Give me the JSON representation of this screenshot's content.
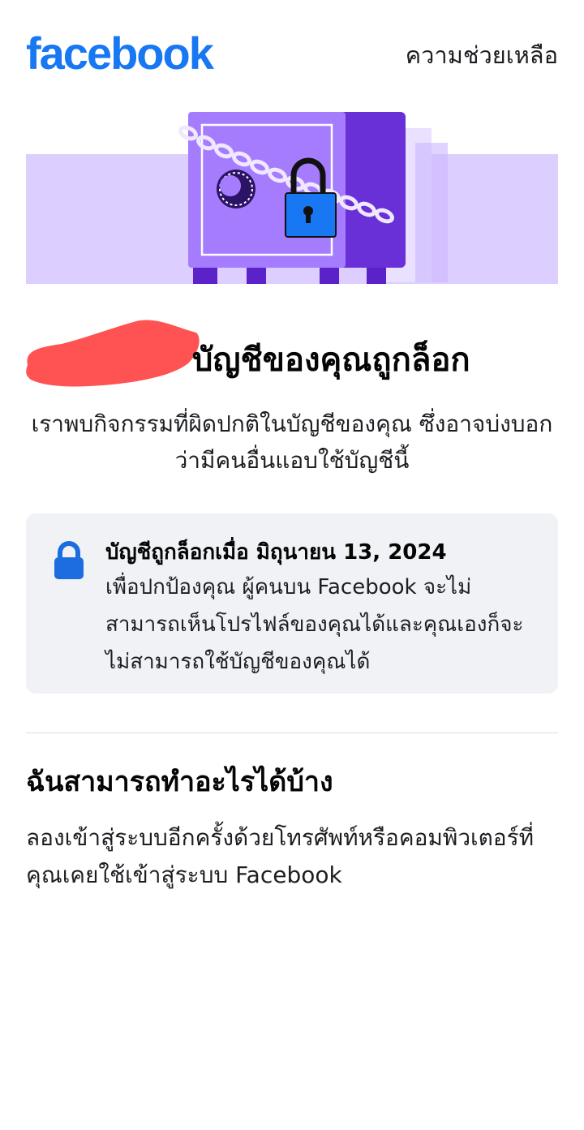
{
  "header": {
    "logo_text": "facebook",
    "help_label": "ความช่วยเหลือ"
  },
  "main": {
    "title": "บัญชีของคุณถูกล็อก",
    "subtitle": "เราพบกิจกรรมที่ผิดปกติในบัญชีของคุณ ซึ่งอาจบ่งบอกว่ามีคนอื่นแอบใช้บัญชีนี้"
  },
  "info_card": {
    "icon": "lock-icon",
    "heading": "บัญชีถูกล็อกเมื่อ มิถุนายน 13, 2024",
    "body": "เพื่อปกป้องคุณ ผู้คนบน Facebook จะไม่สามารถเห็นโปรไฟล์ของคุณได้และคุณเองก็จะไม่สามารถใช้บัญชีของคุณได้"
  },
  "what_can_i_do": {
    "heading": "ฉันสามารถทำอะไรได้บ้าง",
    "body": "ลองเข้าสู่ระบบอีกครั้งด้วยโทรศัพท์หรือคอมพิวเตอร์ที่คุณเคยใช้เข้าสู่ระบบ Facebook"
  },
  "colors": {
    "brand": "#1877f2",
    "card_bg": "#f0f2f5",
    "illustration_bg": "#dccfff",
    "safe_front": "#a67cff",
    "safe_side": "#6a30d8",
    "lock_blue": "#1877f2",
    "redaction": "#ff5252"
  }
}
